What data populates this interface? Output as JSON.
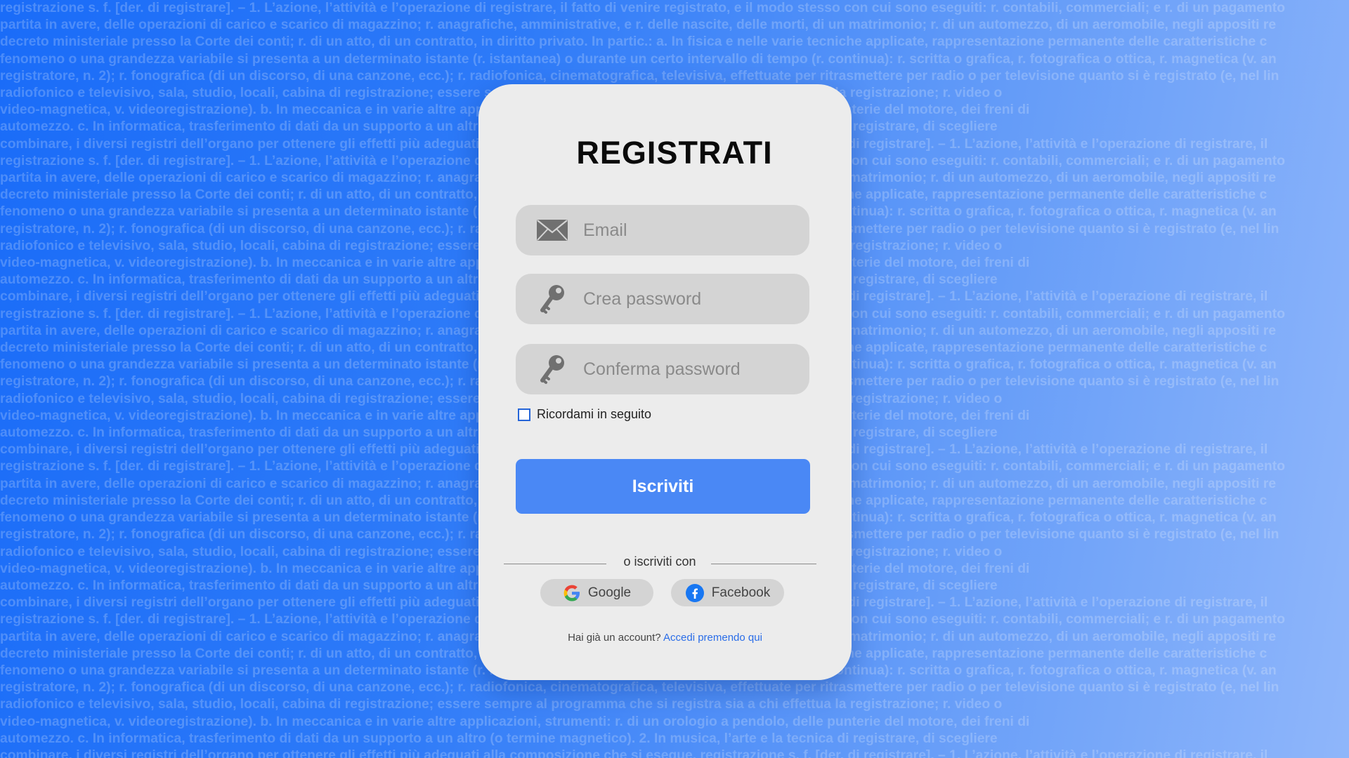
{
  "background": {
    "lines": [
      "registrazione s. f. [der. di registrare]. – 1. L’azione, l’attività e l’operazione di registrare, il fatto di venire registrato, e il modo stesso con cui sono eseguiti: r. contabili, commerciali; e r. di un pagamento",
      "partita in avere, delle operazioni di carico e scarico di magazzino; r. anagrafiche, amministrative, e r. delle nascite, delle morti, di un matrimonio; r. di un automezzo, di un aeromobile, negli appositi re",
      "decreto ministeriale presso la Corte dei conti; r. di un atto, di un contratto, in diritto privato. In partic.: a. In fisica e nelle varie tecniche applicate, rappresentazione permanente delle caratteristiche c",
      "fenomeno o una grandezza variabile si presenta a un determinato istante (r. istantanea) o durante un certo intervallo di tempo (r. continua): r. scritta o grafica, r. fotografica o ottica, r. magnetica (v. an",
      "registratore, n. 2); r. fonografica (di un discorso, di una canzone, ecc.); r. radiofonica, cinematografica, televisiva, effettuate per ritrasmettere per radio o per televisione quanto si è registrato (e, nel lin",
      "radiofonico e televisivo, sala, studio, locali, cabina di registrazione; essere sempre al programma che si registra sia a chi effettua la registrazione; r. video o",
      "video-magnetica, v. videoregistrazione). b. In meccanica e in varie altre applicazioni, strumenti: r. di un orologio a pendolo, delle punterie del motore, dei freni di",
      "automezzo. c. In informatica, trasferimento di dati da un supporto a un altro (o termine magnetico). 2. In musica, l’arte e la tecnica di registrare, di scegliere",
      "combinare, i diversi registri dell’organo per ottenere gli effetti più adeguati alla composizione che si esegue. registrazione s. f. [der. di registrare]. – 1. L’azione, l’attività e l’operazione di registrare, il"
    ]
  },
  "card": {
    "title": "REGISTRATI",
    "email_placeholder": "Email",
    "password_placeholder": "Crea password",
    "confirm_placeholder": "Conferma password",
    "remember_label": "Ricordami in seguito",
    "submit_label": "Iscriviti",
    "divider_text": "o iscriviti con",
    "google_label": "Google",
    "facebook_label": "Facebook",
    "footer_text": "Hai già un account?",
    "footer_link": "Accedi premendo qui"
  },
  "icons": {
    "email": "envelope-icon",
    "password": "key-icon",
    "confirm": "key-icon",
    "google": "google-icon",
    "facebook": "facebook-icon"
  },
  "colors": {
    "accent": "#4a88f5",
    "link": "#2a6de8",
    "field": "#d4d4d4",
    "card": "#ececec"
  }
}
